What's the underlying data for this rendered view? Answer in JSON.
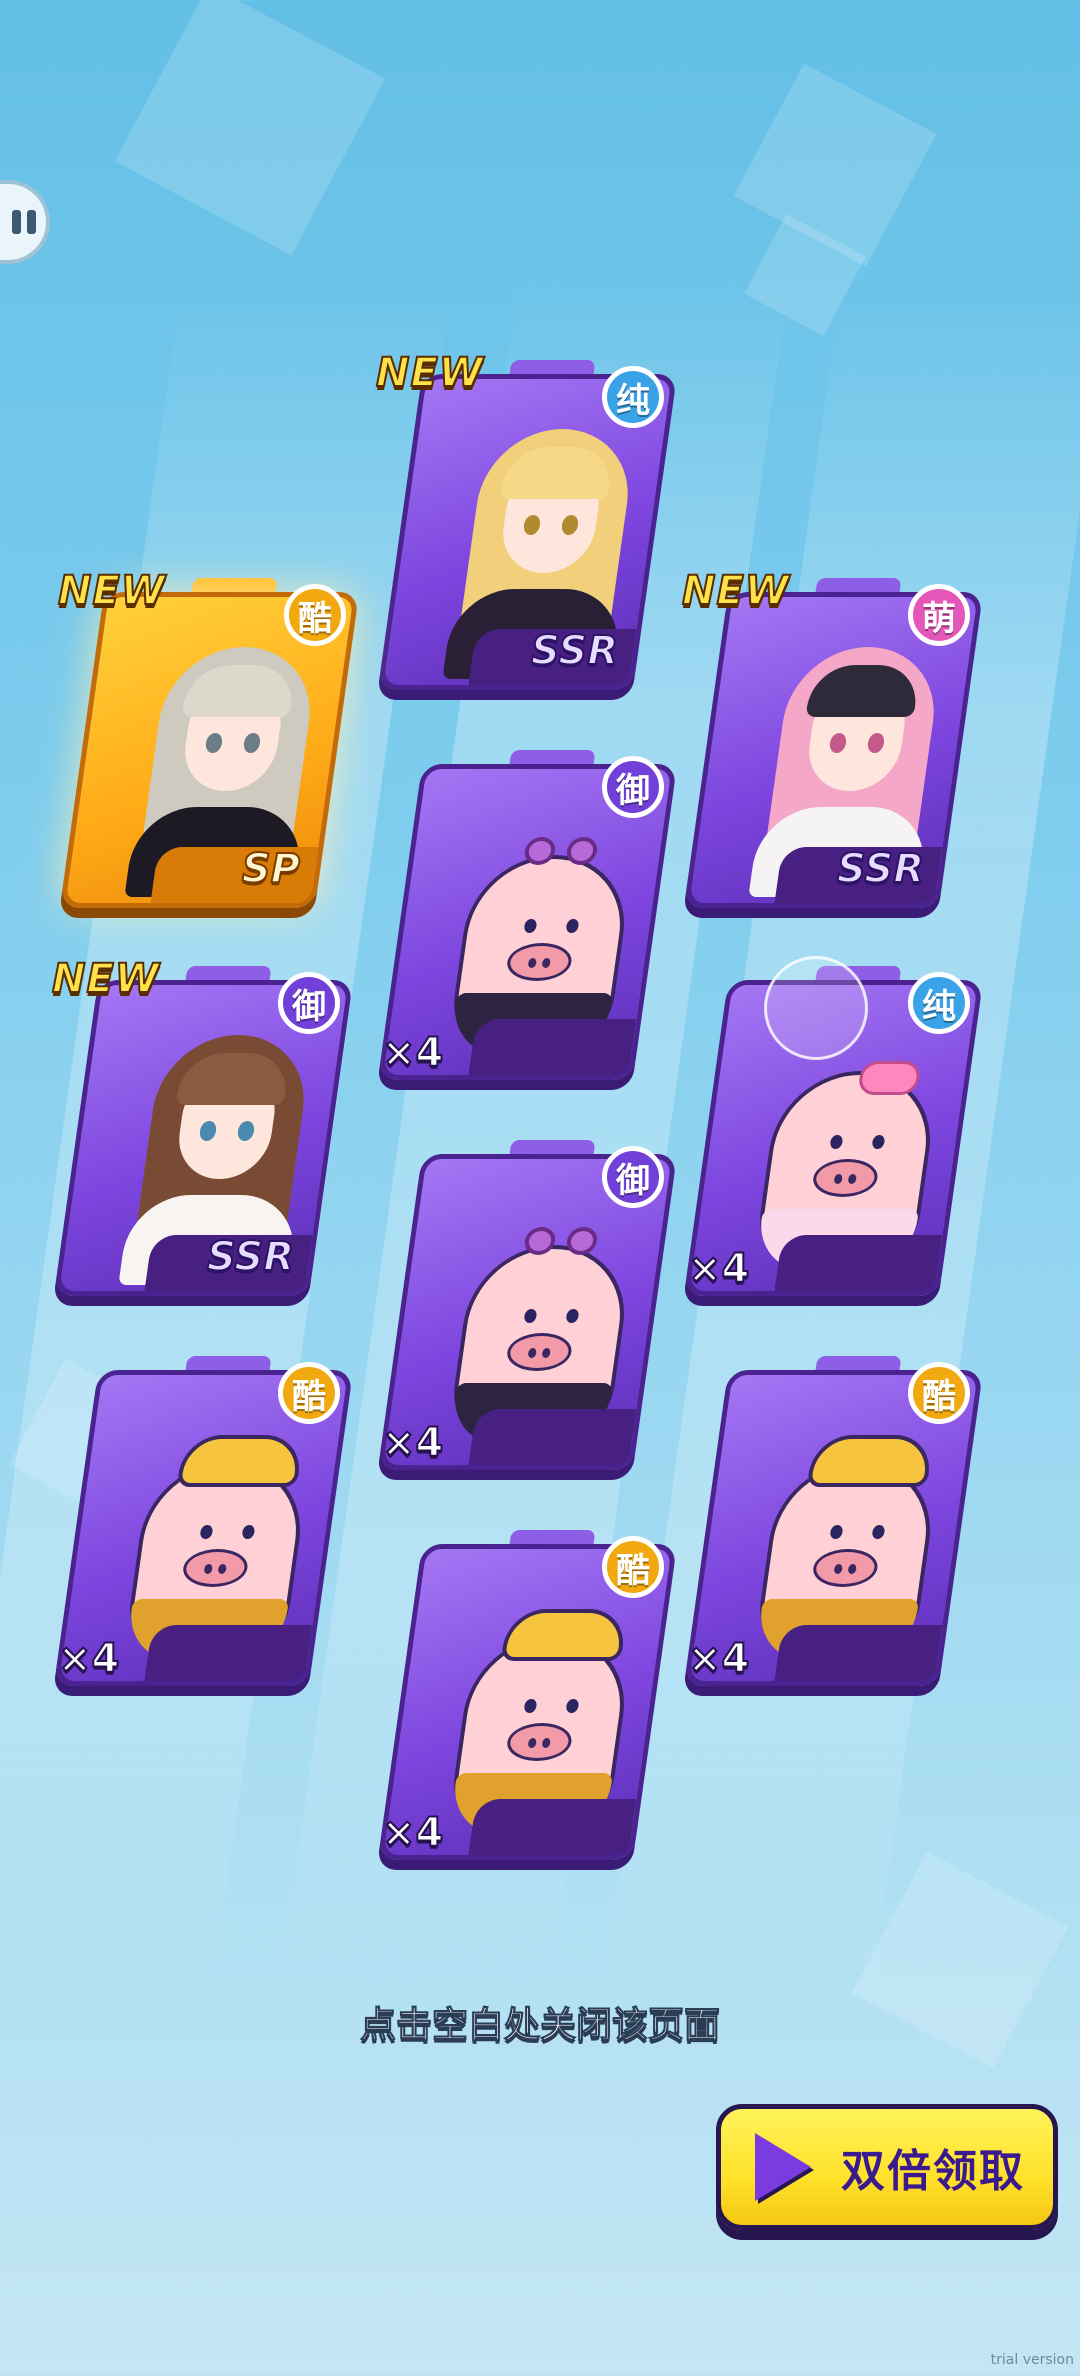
{
  "controls": {
    "pause_icon": "pause-icon"
  },
  "cards": [
    {
      "id": "card-1",
      "art": "girl-blonde",
      "badge": "纯",
      "badge_color": "#3aa3e8",
      "new": "NEW",
      "rarity": "SSR",
      "count": "",
      "frame": "purple"
    },
    {
      "id": "card-2",
      "art": "girl-silver",
      "badge": "酷",
      "badge_color": "#f2a80f",
      "new": "NEW",
      "rarity": "SP",
      "count": "",
      "frame": "gold"
    },
    {
      "id": "card-3",
      "art": "girl-pink",
      "badge": "萌",
      "badge_color": "#e457b8",
      "new": "NEW",
      "rarity": "SSR",
      "count": "",
      "frame": "purple"
    },
    {
      "id": "card-4",
      "art": "pig-glasses",
      "badge": "御",
      "badge_color": "#7040d8",
      "new": "",
      "rarity": "",
      "count": "×4",
      "frame": "purple"
    },
    {
      "id": "card-5",
      "art": "girl-brown",
      "badge": "御",
      "badge_color": "#7040d8",
      "new": "NEW",
      "rarity": "SSR",
      "count": "",
      "frame": "purple"
    },
    {
      "id": "card-6",
      "art": "pig-bow",
      "badge": "纯",
      "badge_color": "#3aa3e8",
      "new": "",
      "rarity": "",
      "count": "×4",
      "frame": "purple"
    },
    {
      "id": "card-7",
      "art": "pig-glasses",
      "badge": "御",
      "badge_color": "#7040d8",
      "new": "",
      "rarity": "",
      "count": "×4",
      "frame": "purple"
    },
    {
      "id": "card-8",
      "art": "pig-cap",
      "badge": "酷",
      "badge_color": "#f2a80f",
      "new": "",
      "rarity": "",
      "count": "×4",
      "frame": "purple"
    },
    {
      "id": "card-9",
      "art": "pig-cap",
      "badge": "酷",
      "badge_color": "#f2a80f",
      "new": "",
      "rarity": "",
      "count": "×4",
      "frame": "purple"
    },
    {
      "id": "card-10",
      "art": "pig-cap",
      "badge": "酷",
      "badge_color": "#f2a80f",
      "new": "",
      "rarity": "",
      "count": "×4",
      "frame": "purple"
    }
  ],
  "hint": "点击空白处关闭该页面",
  "claim_button": {
    "label": "双倍领取",
    "icon": "play-icon"
  },
  "watermark": "trial version"
}
